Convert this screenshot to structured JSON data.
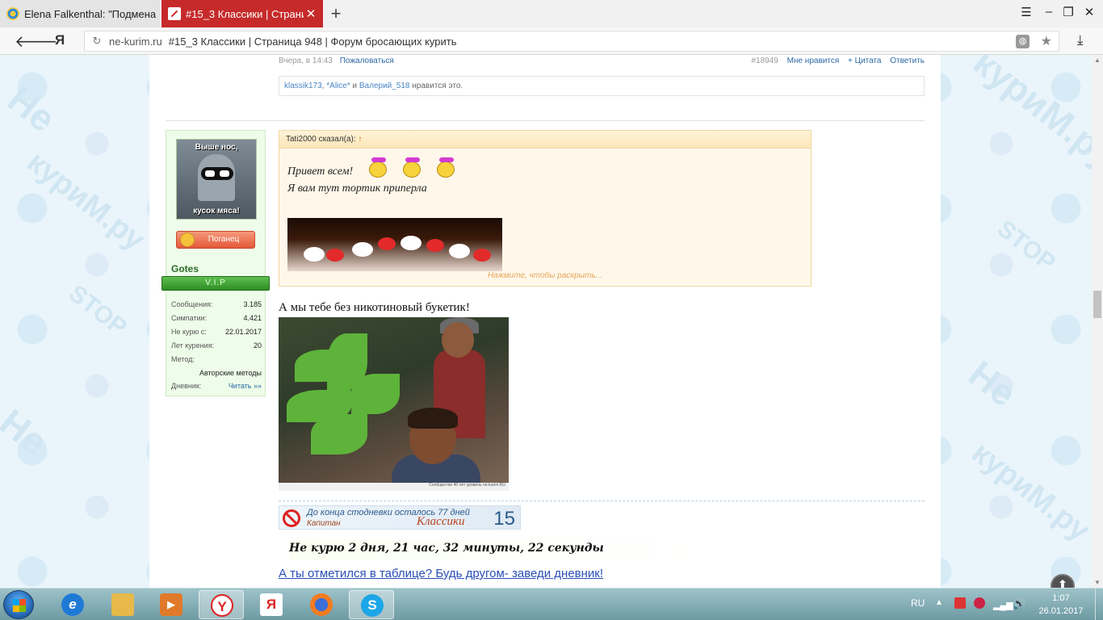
{
  "browser": {
    "tabs": [
      {
        "title": "Elena Falkenthal: \"Подмена"
      },
      {
        "title": "#15_3 Классики | Страни"
      }
    ],
    "address": {
      "domain": "ne-kurim.ru",
      "title": "#15_3 Классики | Страница 948 | Форум бросающих курить"
    },
    "yandex_letter": "Я"
  },
  "prev_post": {
    "time": "Вчера, в 14:43",
    "report": "Пожаловаться",
    "post_num": "#18949",
    "like": "Мне нравится",
    "quote": "+ Цитата",
    "reply": "Ответить",
    "likers": [
      "klassik173",
      "*Alice*",
      "Валерий_518"
    ],
    "likes_and": "и",
    "likes_suffix": "нравится это."
  },
  "user": {
    "avatar_top": "Выше нос,",
    "avatar_bottom": "кусок мяса!",
    "rank": "Поганец",
    "name": "Gotes",
    "badge": "V.I.P",
    "stats": {
      "messages_label": "Сообщения:",
      "messages": "3.185",
      "sympathy_label": "Симпатии:",
      "sympathy": "4.421",
      "quit_label": "Не курю с:",
      "quit": "22.01.2017",
      "years_label": "Лет курения:",
      "years": "20",
      "method_label": "Метод:",
      "method": "Авторские методы",
      "diary_label": "Дневник:",
      "diary": "Читать »»"
    }
  },
  "quote": {
    "author": "Tati2000 сказал(а):",
    "arrow": "↑",
    "line1": "Привет всем!",
    "line2": "Я вам тут тортик приперла",
    "expand": "Нажмите, чтобы раскрыть..."
  },
  "post": {
    "text": "А мы тебе без никотиновый букетик!",
    "photo_caption": "Сообщество 40 лет уровень ne-kurim.RU",
    "counter": {
      "line1": "До конца стодневки осталось 77 дней",
      "line2": "Капитан",
      "group": "Классики",
      "num": "15"
    },
    "timer": "Не курю  2 дня, 21 час, 32 минуты, 22 секунды",
    "diary_link": "А ты отметился в таблице? Будь другом- заведи дневник!"
  },
  "watermarks": [
    "Не",
    "куриМ.ру",
    "STOP",
    "Не",
    "куриМ.ру",
    "STOP",
    "Не",
    "куриМ.ру"
  ],
  "taskbar": {
    "lang": "RU",
    "time": "1:07",
    "date": "26.01.2017"
  }
}
